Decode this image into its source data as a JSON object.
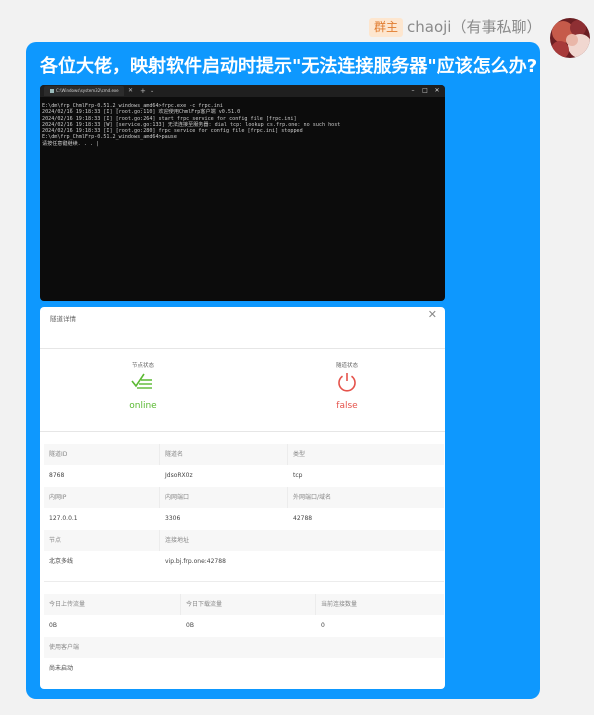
{
  "header": {
    "role_badge": "群主",
    "sender": "chaoji（有事私聊）"
  },
  "message": {
    "text": "各位大佬，映射软件启动时提示\"无法连接服务器\"应该怎么办?"
  },
  "console": {
    "tab_title": "C:\\Windows\\system32\\cmd.exe",
    "lines": [
      "E:\\dm\\frp_ChmlFrp-0.51.2_windows_amd64>frpc.exe -c frpc.ini",
      "2024/02/16 19:18:33 [I] [root.go:110] 欢迎使用ChmlFrp客户端 v0.51.0",
      "2024/02/16 19:18:33 [I] [root.go:264] start frpc service for config file [frpc.ini]",
      "2024/02/16 19:18:33 [W] [service.go:133] 无法连接至服务器: dial tcp: lookup cs.frp.one: no such host",
      "2024/02/16 19:18:33 [I] [root.go:280] frpc service for config file [frpc.ini] stopped",
      "",
      "E:\\dm\\frp_ChmlFrp-0.51.2_windows_amd64>pause",
      "请按任意键继续. . . |"
    ]
  },
  "panel": {
    "title": "隧道详情",
    "node_status_label": "节点状态",
    "node_status_value": "online",
    "tunnel_status_label": "隧道状态",
    "tunnel_status_value": "false",
    "colors": {
      "online": "#5ab932",
      "false": "#e5534b"
    },
    "table1": [
      {
        "head": [
          "隧道ID",
          "隧道名",
          "类型"
        ],
        "vals": [
          "8768",
          "JdsoRX0z",
          "tcp"
        ]
      },
      {
        "head": [
          "内网IP",
          "内网端口",
          "外网端口/域名"
        ],
        "vals": [
          "127.0.0.1",
          "3306",
          "42788"
        ]
      }
    ],
    "node_head": [
      "节点",
      "连接地址"
    ],
    "node_vals": [
      "北京多线",
      "vip.bj.frp.one:42788"
    ],
    "table2": {
      "head": [
        "今日上传流量",
        "今日下载流量",
        "当前连接数量"
      ],
      "vals": [
        "0B",
        "0B",
        "0"
      ]
    },
    "client_head": "使用客户端",
    "client_val": "尚未启动"
  }
}
